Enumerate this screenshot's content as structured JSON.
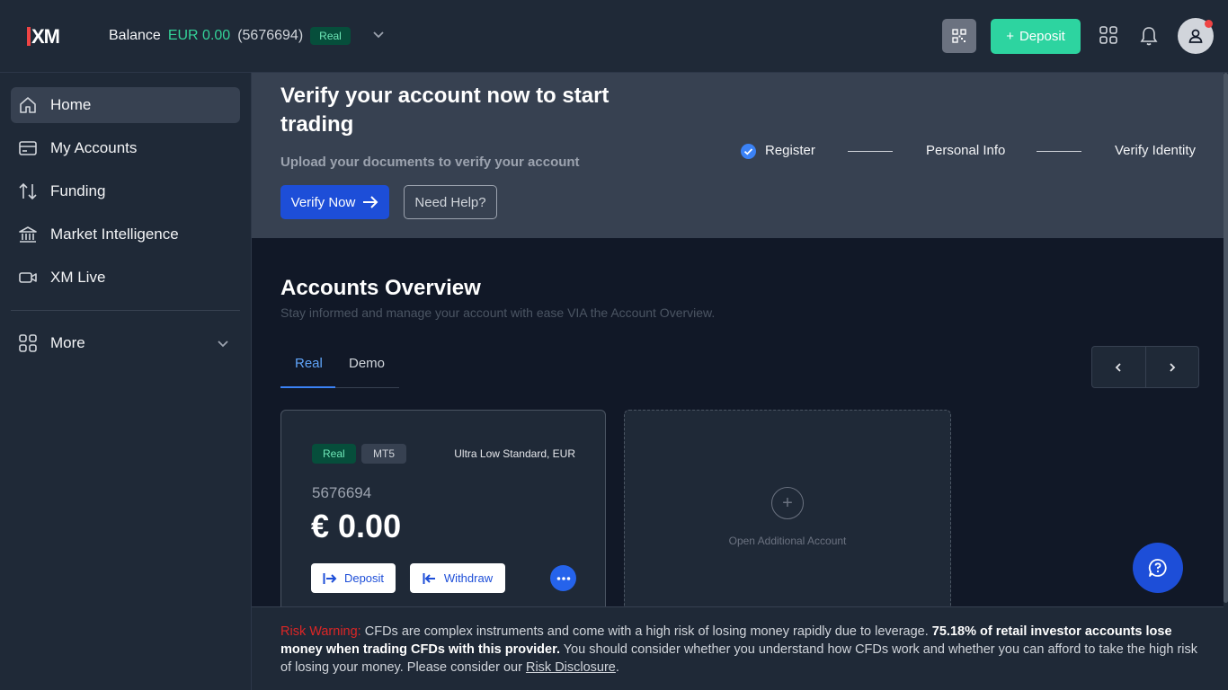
{
  "header": {
    "logo_text": "XM",
    "balance_label": "Balance",
    "balance_amount": "EUR 0.00",
    "account_number": "(5676694)",
    "account_type": "Real",
    "deposit_label": "Deposit",
    "notification_dot_color": "#ef4444"
  },
  "sidebar": {
    "items": [
      {
        "label": "Home",
        "icon": "home-icon",
        "active": true
      },
      {
        "label": "My Accounts",
        "icon": "card-icon"
      },
      {
        "label": "Funding",
        "icon": "transfer-arrows-icon"
      },
      {
        "label": "Market Intelligence",
        "icon": "bank-icon"
      },
      {
        "label": "XM Live",
        "icon": "video-icon"
      }
    ],
    "more_label": "More"
  },
  "banner": {
    "title": "Verify your account now to start trading",
    "subtitle": "Upload your documents to verify your account",
    "verify_button": "Verify Now",
    "help_button": "Need Help?",
    "steps": [
      "Register",
      "Personal Info",
      "Verify Identity"
    ]
  },
  "overview": {
    "title": "Accounts Overview",
    "subtitle": "Stay informed and manage your account with ease VIA the Account Overview.",
    "tabs": [
      "Real",
      "Demo"
    ],
    "active_tab": "Real"
  },
  "account_card": {
    "badge_type": "Real",
    "badge_platform": "MT5",
    "account_kind": "Ultra Low Standard, EUR",
    "number": "5676694",
    "balance": "€ 0.00",
    "deposit_label": "Deposit",
    "withdraw_label": "Withdraw"
  },
  "add_account": {
    "label": "Open Additional Account"
  },
  "risk": {
    "prefix": "Risk Warning:",
    "text1": " CFDs are complex instruments and come with a high risk of losing money rapidly due to leverage. ",
    "bold": "75.18% of retail investor accounts lose money when trading CFDs with this provider.",
    "text2": " You should consider whether you understand how CFDs work and whether you can afford to take the high risk of losing your money. Please consider our ",
    "link": "Risk Disclosure",
    "end": "."
  },
  "colors": {
    "accent_green": "#2dd4a0",
    "primary_blue": "#1d4ed8",
    "warning_red": "#dc2626"
  }
}
